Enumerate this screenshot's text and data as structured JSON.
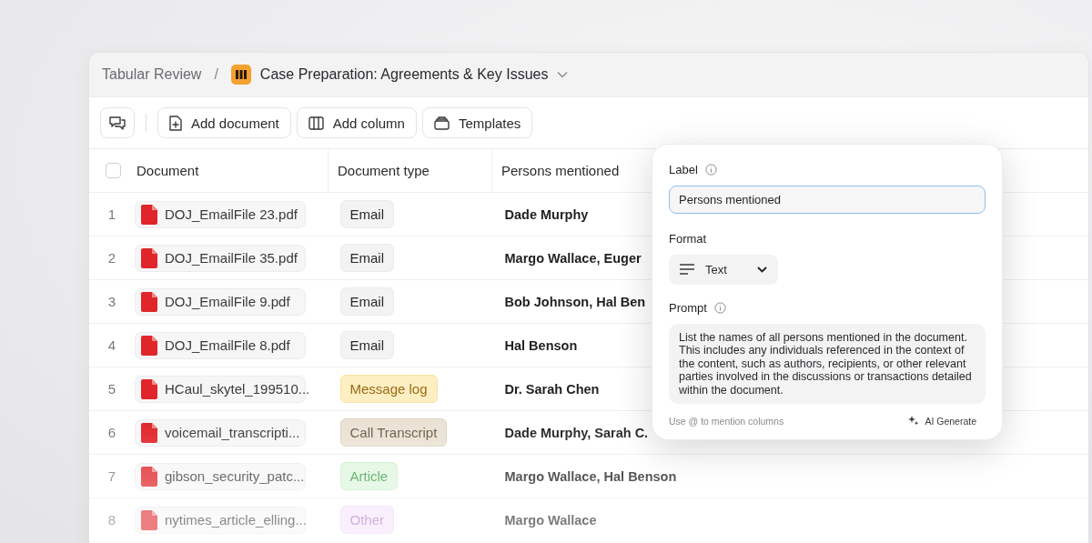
{
  "breadcrumb": {
    "parent": "Tabular Review",
    "separator": "/",
    "title": "Case Preparation: Agreements & Key Issues"
  },
  "toolbar": [
    {
      "kind": "chat"
    },
    {
      "kind": "document",
      "label": "Add document"
    },
    {
      "kind": "column",
      "label": "Add column"
    },
    {
      "kind": "templates",
      "label": "Templates"
    }
  ],
  "table": {
    "select_all": {
      "checked": false
    },
    "columns": [
      "Document",
      "Document type",
      "Persons mentioned"
    ],
    "rows": [
      {
        "index": "1",
        "document": "DOJ_EmailFile 23.pdf",
        "doc_type": {
          "label": "Email",
          "kind": "neutral"
        },
        "persons": "Dade Murphy"
      },
      {
        "index": "2",
        "document": "DOJ_EmailFile 35.pdf",
        "doc_type": {
          "label": "Email",
          "kind": "neutral"
        },
        "persons": "Margo Wallace, Euger"
      },
      {
        "index": "3",
        "document": "DOJ_EmailFile 9.pdf",
        "doc_type": {
          "label": "Email",
          "kind": "neutral"
        },
        "persons": "Bob Johnson, Hal Ben"
      },
      {
        "index": "4",
        "document": "DOJ_EmailFile 8.pdf",
        "doc_type": {
          "label": "Email",
          "kind": "neutral"
        },
        "persons": "Hal Benson"
      },
      {
        "index": "5",
        "document": "HCaul_skytel_199510...",
        "doc_type": {
          "label": "Message log",
          "kind": "yellow"
        },
        "persons": "Dr. Sarah Chen"
      },
      {
        "index": "6",
        "document": "voicemail_transcripti...",
        "doc_type": {
          "label": "Call Transcript",
          "kind": "brown"
        },
        "persons": "Dade Murphy, Sarah C."
      },
      {
        "index": "7",
        "document": "gibson_security_patc...",
        "doc_type": {
          "label": "Article",
          "kind": "green"
        },
        "persons": "Margo Wallace, Hal Benson"
      },
      {
        "index": "8",
        "document": "nytimes_article_elling...",
        "doc_type": {
          "label": "Other",
          "kind": "purple"
        },
        "persons": "Margo Wallace"
      }
    ]
  },
  "column_editor": {
    "label_title": "Label",
    "label_value": "Persons mentioned",
    "format_title": "Format",
    "format_value": "Text",
    "prompt_title": "Prompt",
    "prompt_value": "List the names of all persons mentioned in the document. This includes any individuals referenced in the context of the content, such as authors, recipients, or other relevant parties involved in the discussions or transactions detailed within the document.",
    "hint": "Use @ to mention columns",
    "generate": "AI Generate"
  }
}
